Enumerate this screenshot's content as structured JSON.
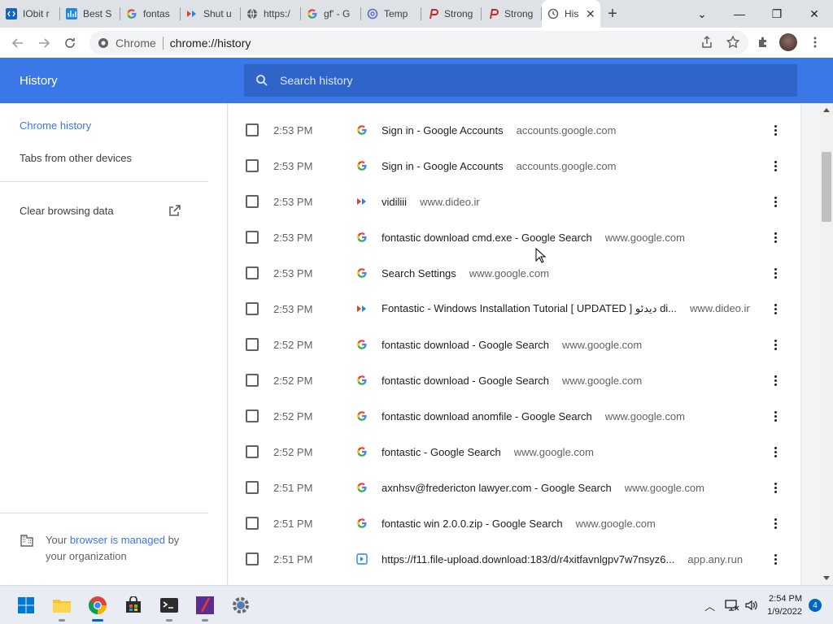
{
  "tabs": [
    {
      "title": "IObit r",
      "icon": "iobit-icon",
      "color": "#1565c0"
    },
    {
      "title": "Best S",
      "icon": "chart-icon",
      "color": "#1e88e5"
    },
    {
      "title": "fontas",
      "icon": "google-icon",
      "color": "#ffffff"
    },
    {
      "title": "Shut u",
      "icon": "dideo-icon",
      "color": "#d81b60"
    },
    {
      "title": "https:/",
      "icon": "globe-icon",
      "color": "#5f6368"
    },
    {
      "title": "gf' - G",
      "icon": "google-icon",
      "color": "#ffffff"
    },
    {
      "title": "Temp",
      "icon": "at-icon",
      "color": "#5c6bc0"
    },
    {
      "title": "Strong",
      "icon": "strong-icon",
      "color": "#c62828"
    },
    {
      "title": "Strong",
      "icon": "strong-icon",
      "color": "#c62828"
    },
    {
      "title": "His",
      "icon": "history-icon",
      "color": "#3b78e7"
    }
  ],
  "omnibox": {
    "site": "Chrome",
    "url": "chrome://history"
  },
  "header": {
    "title": "History",
    "search_placeholder": "Search history"
  },
  "sidebar": {
    "items": [
      {
        "label": "Chrome history"
      },
      {
        "label": "Tabs from other devices"
      },
      {
        "label": "Clear browsing data"
      }
    ],
    "managed_prefix": "Your ",
    "managed_link": "browser is managed",
    "managed_suffix": " by your organization"
  },
  "history": [
    {
      "time": "2:53 PM",
      "title": "Sign in - Google Accounts",
      "domain": "accounts.google.com",
      "icon": "google"
    },
    {
      "time": "2:53 PM",
      "title": "Sign in - Google Accounts",
      "domain": "accounts.google.com",
      "icon": "google"
    },
    {
      "time": "2:53 PM",
      "title": "vidiliii",
      "domain": "www.dideo.ir",
      "icon": "dideo"
    },
    {
      "time": "2:53 PM",
      "title": "fontastic download cmd.exe - Google Search",
      "domain": "www.google.com",
      "icon": "google"
    },
    {
      "time": "2:53 PM",
      "title": "Search Settings",
      "domain": "www.google.com",
      "icon": "google"
    },
    {
      "time": "2:53 PM",
      "title": "Fontastic - Windows Installation Tutorial [ UPDATED ] ديدئو di...",
      "domain": "www.dideo.ir",
      "icon": "dideo"
    },
    {
      "time": "2:52 PM",
      "title": "fontastic download - Google Search",
      "domain": "www.google.com",
      "icon": "google"
    },
    {
      "time": "2:52 PM",
      "title": "fontastic download - Google Search",
      "domain": "www.google.com",
      "icon": "google"
    },
    {
      "time": "2:52 PM",
      "title": "fontastic download anomfile - Google Search",
      "domain": "www.google.com",
      "icon": "google"
    },
    {
      "time": "2:52 PM",
      "title": "fontastic - Google Search",
      "domain": "www.google.com",
      "icon": "google"
    },
    {
      "time": "2:51 PM",
      "title": "axnhsv@fredericton lawyer.com - Google Search",
      "domain": "www.google.com",
      "icon": "google"
    },
    {
      "time": "2:51 PM",
      "title": "fontastic win 2.0.0.zip - Google Search",
      "domain": "www.google.com",
      "icon": "google"
    },
    {
      "time": "2:51 PM",
      "title": "https://f11.file-upload.download:183/d/r4xitfavnlgpv7w7nsyz6...",
      "domain": "app.any.run",
      "icon": "anyrun"
    }
  ],
  "taskbar": {
    "time": "2:54 PM",
    "date": "1/9/2022",
    "notifications": "4"
  },
  "colors": {
    "accent": "#3b78e7",
    "header_search": "#2f64c8"
  }
}
